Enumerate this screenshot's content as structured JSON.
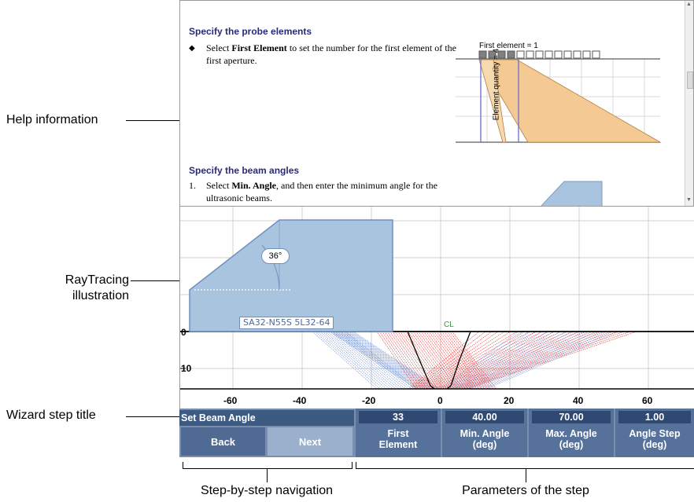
{
  "callouts": {
    "help": "Help information",
    "ray_line1": "RayTracing",
    "ray_line2": "illustration",
    "wizard": "Wizard step title",
    "nav": "Step-by-step navigation",
    "params": "Parameters of the step"
  },
  "help": {
    "heading1": "Specify the probe elements",
    "bullet": "◆",
    "p1_pre": "Select ",
    "p1_bold": "First Element",
    "p1_post": " to set the number for the first element of the first aperture.",
    "fig_label": "First element = 1",
    "fig_vlabel": "Element quantity = 4",
    "heading2": "Specify the beam angles",
    "p2_num": "1.",
    "p2_pre": "Select ",
    "p2_bold": "Min. Angle",
    "p2_post": ", and then enter the minimum angle for the ultrasonic beams."
  },
  "ray": {
    "angle_label": "36°",
    "probe_label": "SA32-N55S 5L32-64",
    "cl_label": "CL",
    "depth_ticks": [
      "0",
      "10"
    ],
    "x_ticks": [
      "-60",
      "-40",
      "-20",
      "0",
      "20",
      "40",
      "60"
    ]
  },
  "wizard": {
    "title": "Set Beam Angle",
    "back": "Back",
    "next": "Next",
    "params": [
      {
        "value": "33",
        "label1": "First",
        "label2": "Element"
      },
      {
        "value": "40.00",
        "label1": "Min. Angle",
        "label2": "(deg)"
      },
      {
        "value": "70.00",
        "label1": "Max. Angle",
        "label2": "(deg)"
      },
      {
        "value": "1.00",
        "label1": "Angle Step",
        "label2": "(deg)"
      }
    ]
  },
  "colors": {
    "probe_fill": "#a9c4de",
    "blue_rays": "#6f8fd0",
    "red_rays": "#e03030",
    "bar_bg": "#7a8fad",
    "value_bg": "#3d5a82",
    "orange_fill": "#f5c994"
  }
}
